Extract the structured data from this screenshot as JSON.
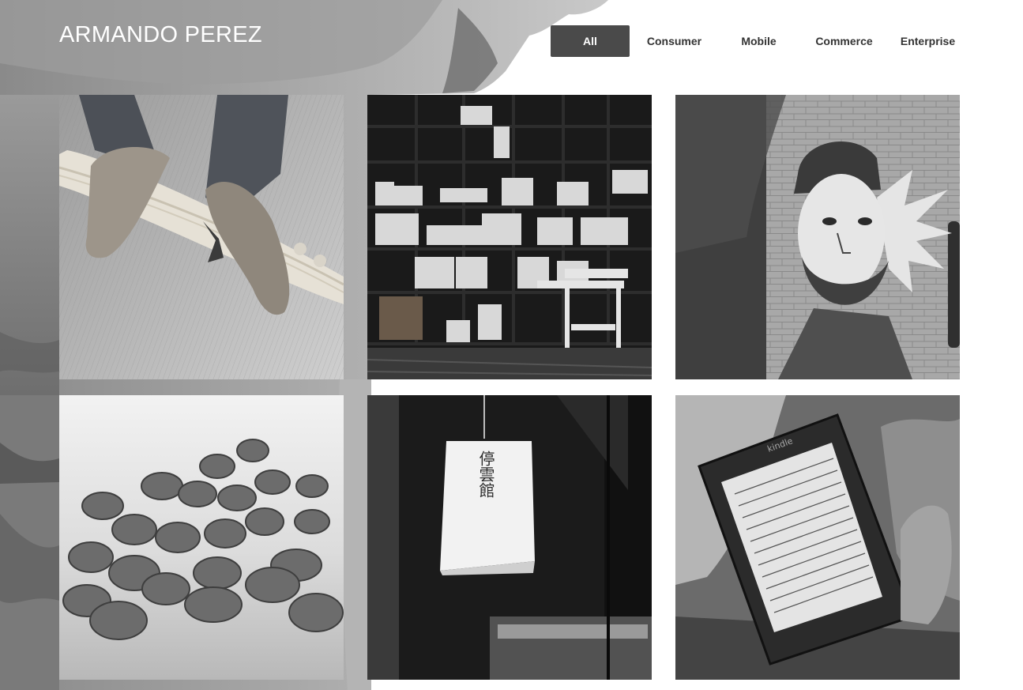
{
  "header": {
    "title": "ARMANDO PEREZ"
  },
  "filters": {
    "items": [
      {
        "label": "All",
        "active": true
      },
      {
        "label": "Consumer",
        "active": false
      },
      {
        "label": "Mobile",
        "active": false
      },
      {
        "label": "Commerce",
        "active": false
      },
      {
        "label": "Enterprise",
        "active": false
      }
    ]
  },
  "gallery": {
    "items": [
      {
        "subject": "skateboard-shoes"
      },
      {
        "subject": "bookshelf"
      },
      {
        "subject": "brick-wall-mural"
      },
      {
        "subject": "coffee-beans"
      },
      {
        "subject": "paper-lantern",
        "lantern_text": "停雲館"
      },
      {
        "subject": "kindle-reader",
        "device_text": "kindle"
      }
    ]
  },
  "colors": {
    "active_filter_bg": "#4a4a4a",
    "filter_text": "#333333",
    "title_text": "#ffffff"
  }
}
